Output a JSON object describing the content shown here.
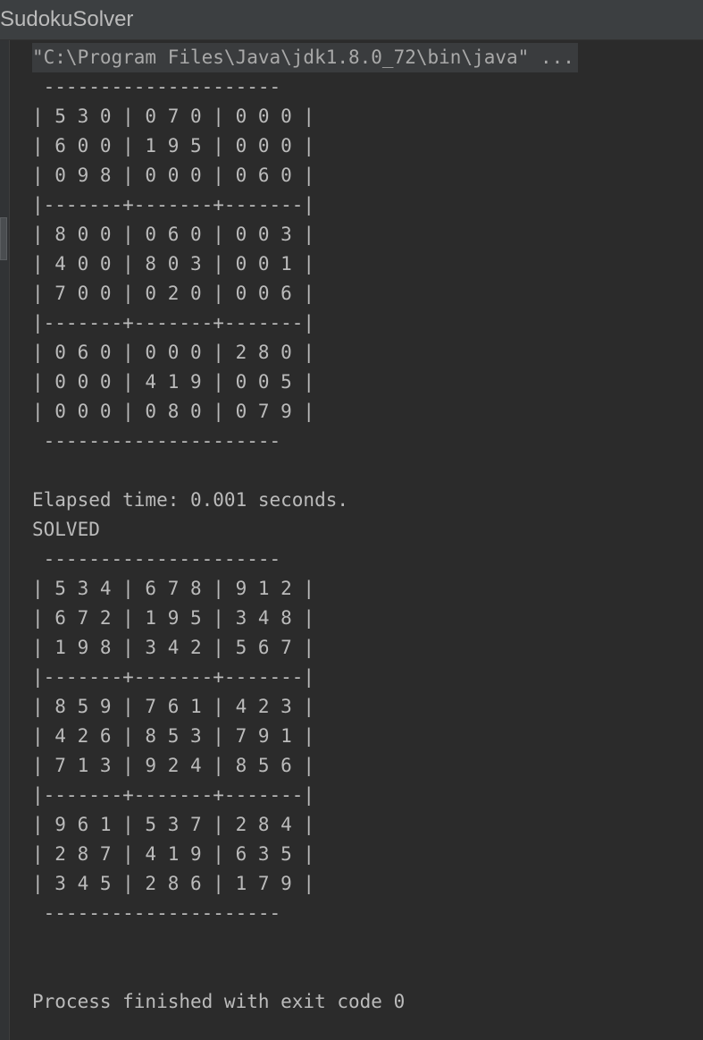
{
  "window": {
    "title": "SudokuSolver"
  },
  "console": {
    "command": "\"C:\\Program Files\\Java\\jdk1.8.0_72\\bin\\java\" ...",
    "lines": [
      " ---------------------",
      "| 5 3 0 | 0 7 0 | 0 0 0 |",
      "| 6 0 0 | 1 9 5 | 0 0 0 |",
      "| 0 9 8 | 0 0 0 | 0 6 0 |",
      "|-------+-------+-------|",
      "| 8 0 0 | 0 6 0 | 0 0 3 |",
      "| 4 0 0 | 8 0 3 | 0 0 1 |",
      "| 7 0 0 | 0 2 0 | 0 0 6 |",
      "|-------+-------+-------|",
      "| 0 6 0 | 0 0 0 | 2 8 0 |",
      "| 0 0 0 | 4 1 9 | 0 0 5 |",
      "| 0 0 0 | 0 8 0 | 0 7 9 |",
      " ---------------------",
      "",
      "Elapsed time: 0.001 seconds.",
      "SOLVED",
      " ---------------------",
      "| 5 3 4 | 6 7 8 | 9 1 2 |",
      "| 6 7 2 | 1 9 5 | 3 4 8 |",
      "| 1 9 8 | 3 4 2 | 5 6 7 |",
      "|-------+-------+-------|",
      "| 8 5 9 | 7 6 1 | 4 2 3 |",
      "| 4 2 6 | 8 5 3 | 7 9 1 |",
      "| 7 1 3 | 9 2 4 | 8 5 6 |",
      "|-------+-------+-------|",
      "| 9 6 1 | 5 3 7 | 2 8 4 |",
      "| 2 8 7 | 4 1 9 | 6 3 5 |",
      "| 3 4 5 | 2 8 6 | 1 7 9 |",
      " ---------------------",
      "",
      "",
      "Process finished with exit code 0"
    ]
  }
}
